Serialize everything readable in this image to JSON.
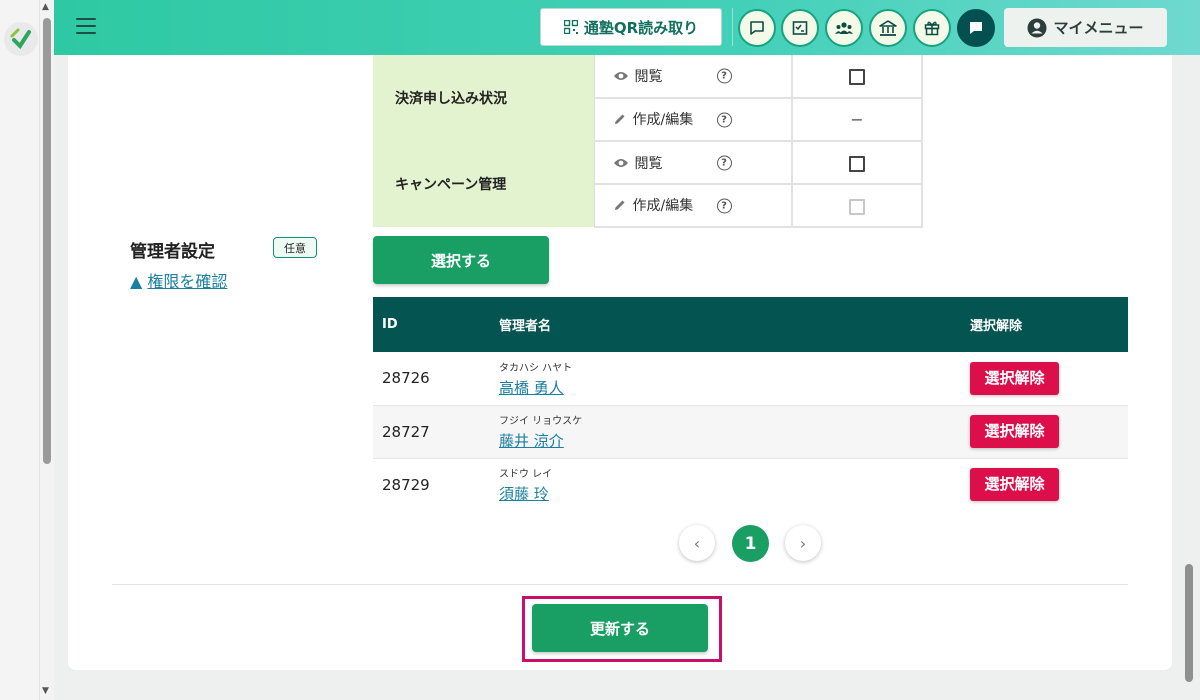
{
  "header": {
    "qr_label": "通塾QR読み取り",
    "my_menu_label": "マイメニュー",
    "icons": [
      "chat-bubble-icon",
      "checklist-icon",
      "group-icon",
      "bank-icon",
      "gift-icon",
      "message-icon"
    ]
  },
  "permissions": [
    {
      "category": "決済申し込み状況",
      "rows": [
        {
          "label": "閲覧",
          "icon": "eye-icon",
          "state": "checkbox"
        },
        {
          "label": "作成/編集",
          "icon": "pencil-icon",
          "state": "dash",
          "dash": "−"
        }
      ]
    },
    {
      "category": "キャンペーン管理",
      "rows": [
        {
          "label": "閲覧",
          "icon": "eye-icon",
          "state": "checkbox"
        },
        {
          "label": "作成/編集",
          "icon": "pencil-icon",
          "state": "checkbox-disabled"
        }
      ]
    }
  ],
  "admin": {
    "title": "管理者設定",
    "badge": "任意",
    "perm_link": "権限を確認",
    "perm_link_prefix": "▲",
    "select_label": "選択する",
    "columns": {
      "id": "ID",
      "name": "管理者名",
      "action": "選択解除"
    },
    "rows": [
      {
        "id": "28726",
        "kana": "タカハシ ハヤト",
        "name": "高橋 勇人",
        "action": "選択解除"
      },
      {
        "id": "28727",
        "kana": "フジイ リョウスケ",
        "name": "藤井 涼介",
        "action": "選択解除"
      },
      {
        "id": "28729",
        "kana": "スドウ レイ",
        "name": "須藤 玲",
        "action": "選択解除"
      }
    ]
  },
  "pagination": {
    "current": "1",
    "prev": "‹",
    "next": "›"
  },
  "update_label": "更新する",
  "colors": {
    "accent": "#199e63",
    "danger": "#dc0f4b",
    "header_table": "#045451",
    "category_bg": "#e4f3cf",
    "highlight": "#c8106a"
  }
}
